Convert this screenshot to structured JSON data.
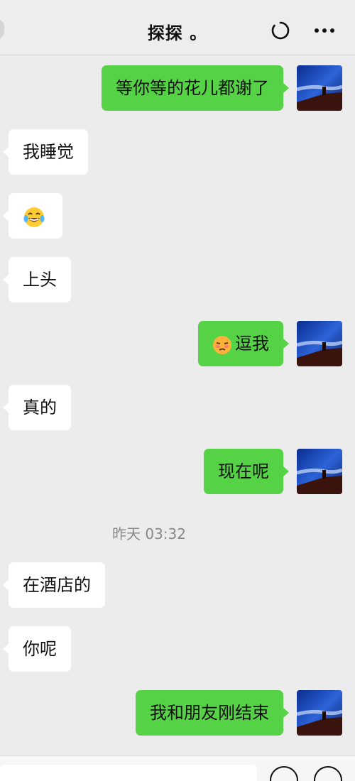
{
  "header": {
    "title": "探探 。",
    "icons": [
      "refresh-circle-icon",
      "more-icon"
    ]
  },
  "messages": [
    {
      "side": "right",
      "text": "等你等的花儿都谢了"
    },
    {
      "side": "left",
      "text": "我睡觉"
    },
    {
      "side": "left",
      "emoji": "laughing-tears-emoji"
    },
    {
      "side": "left",
      "text": "上头"
    },
    {
      "side": "right",
      "emoji": "unamused-emoji",
      "text": "逗我"
    },
    {
      "side": "left",
      "text": "真的"
    },
    {
      "side": "right",
      "text": "现在呢"
    },
    {
      "side": "left",
      "text": "在酒店的"
    },
    {
      "side": "left",
      "text": "你呢"
    },
    {
      "side": "right",
      "text": "我和朋友刚结束"
    }
  ],
  "timestamp": "昨天 03:32",
  "colors": {
    "sent_bubble": "#56d246",
    "received_bubble": "#ffffff",
    "background": "#ececec"
  },
  "bottom_bar": {
    "icons": [
      "emoji-icon",
      "plus-icon"
    ]
  }
}
